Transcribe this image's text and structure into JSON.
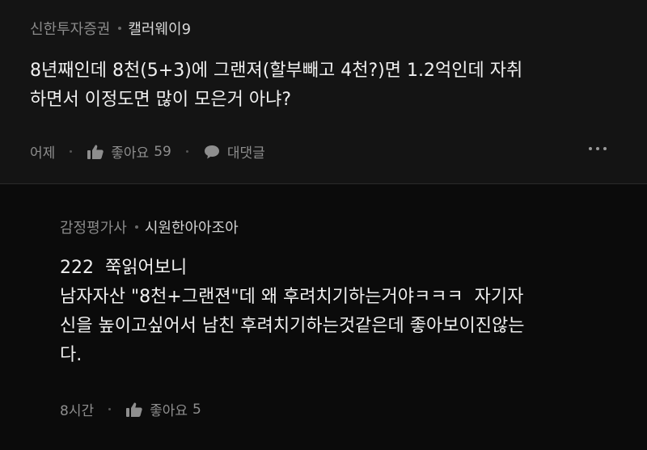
{
  "comments": [
    {
      "company": "신한투자증권",
      "nickname": "캘러웨이9",
      "body": "8년째인데 8천(5+3)에 그랜져(할부빼고 4천?)면 1.2억인데 자취\n하면서 이정도면 많이 모은거 아냐?",
      "time": "어제",
      "like_label": "좋아요",
      "like_count": "59",
      "reply_label": "대댓글"
    },
    {
      "company": "감정평가사",
      "nickname": "시원한아아조아",
      "body": "222  쭉읽어보니\n남자자산 \"8천+그랜젼\"데 왜 후려치기하는거야ㅋㅋㅋ  자기자\n신을 높이고싶어서 남친 후려치기하는것같은데 좋아보이진않는\n다.",
      "time": "8시간",
      "like_label": "좋아요",
      "like_count": "5"
    }
  ],
  "icons": {
    "like": "thumbs-up-icon",
    "reply": "speech-bubble-icon",
    "more": "more-dots-icon"
  },
  "colors": {
    "background": "#0b0b0b",
    "main_comment_bg": "#141414",
    "text": "#f0f0f0",
    "meta": "#8e8e8e"
  }
}
